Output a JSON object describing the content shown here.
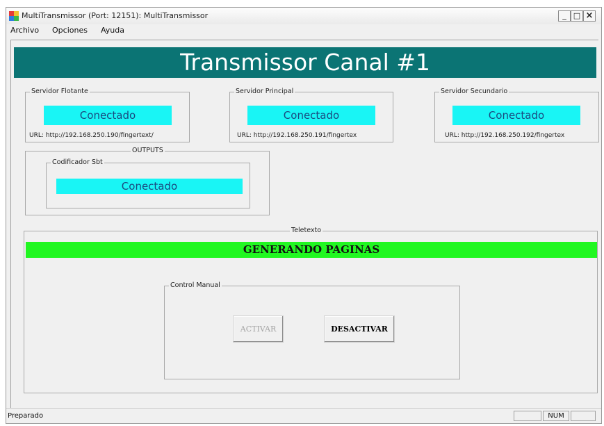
{
  "window": {
    "title": "MultiTransmissor (Port: 12151): MultiTransmissor",
    "min_glyph": "_",
    "max_glyph": "□",
    "close_glyph": "×"
  },
  "menu": {
    "archivo": "Archivo",
    "opciones": "Opciones",
    "ayuda": "Ayuda"
  },
  "banner": {
    "title": "Transmissor Canal #1"
  },
  "servers": [
    {
      "legend": "Servidor Flotante",
      "status": "Conectado",
      "url": "URL:  http://192.168.250.190/fingertext/"
    },
    {
      "legend": "Servidor Principal",
      "status": "Conectado",
      "url": "URL:  http://192.168.250.191/fingertex"
    },
    {
      "legend": "Servidor Secundario",
      "status": "Conectado",
      "url": "URL:  http://192.168.250.192/fingertex"
    }
  ],
  "outputs": {
    "legend": "OUTPUTS",
    "codificador": {
      "legend": "Codificador Sbt",
      "status": "Conectado"
    }
  },
  "teletexto": {
    "legend": "Teletexto",
    "status": "GENERANDO PAGINAS",
    "control": {
      "legend": "Control Manual",
      "activar": "ACTIVAR",
      "desactivar": "DESACTIVAR"
    }
  },
  "statusbar": {
    "text": "Preparado",
    "num": "NUM"
  },
  "colors": {
    "banner": "#0b7474",
    "connected": "#19f5f5",
    "generating": "#21f721"
  },
  "icons": [
    "app-icon",
    "minimize-icon",
    "maximize-icon",
    "close-icon"
  ]
}
